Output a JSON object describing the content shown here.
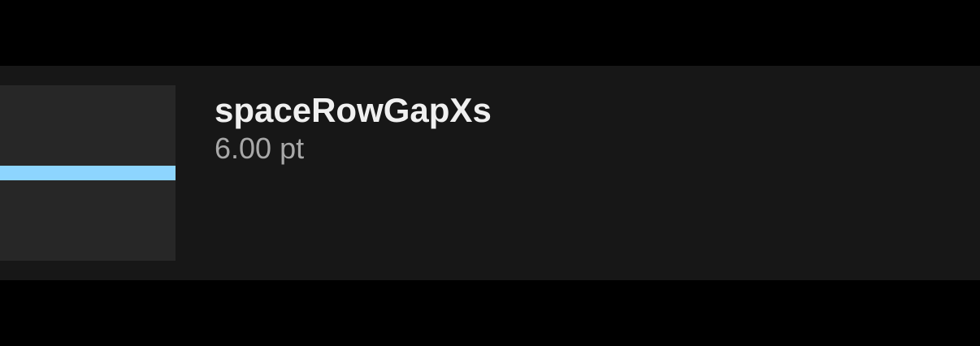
{
  "token": {
    "name": "spaceRowGapXs",
    "value": "6.00 pt"
  },
  "colors": {
    "page_background": "#000000",
    "row_background": "#171717",
    "preview_background": "#272727",
    "gap_indicator": "#8dd5fe",
    "name_text": "#f0f0f0",
    "value_text": "#a8a8a8"
  },
  "preview": {
    "kind": "row-gap-indicator"
  }
}
